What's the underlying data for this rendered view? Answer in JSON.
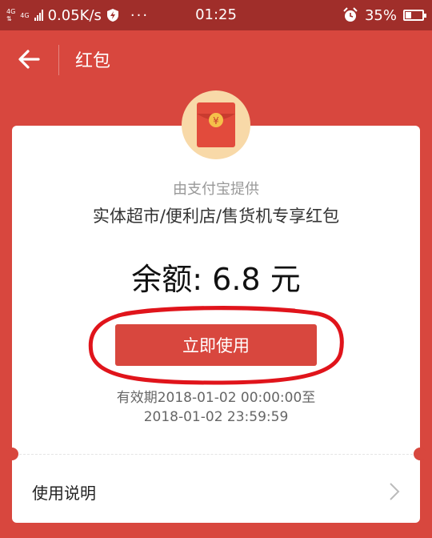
{
  "status_bar": {
    "network_left": "4G",
    "network_right": "4G",
    "speed": "0.05K/s",
    "dots": "···",
    "time": "01:25",
    "battery": "35%"
  },
  "nav": {
    "title": "红包"
  },
  "card": {
    "provider": "由支付宝提供",
    "subtitle": "实体超市/便利店/售货机专享红包",
    "balance": "余额: 6.8 元",
    "use_button": "立即使用",
    "validity_line1": "有效期2018-01-02 00:00:00至",
    "validity_line2": "2018-01-02 23:59:59",
    "instructions": "使用说明",
    "yen_symbol": "¥"
  },
  "colors": {
    "brand_red": "#d8473e",
    "status_bar": "#a02e2a",
    "avatar_bg": "#f8d9a8",
    "annotation_red": "#e0141b"
  }
}
